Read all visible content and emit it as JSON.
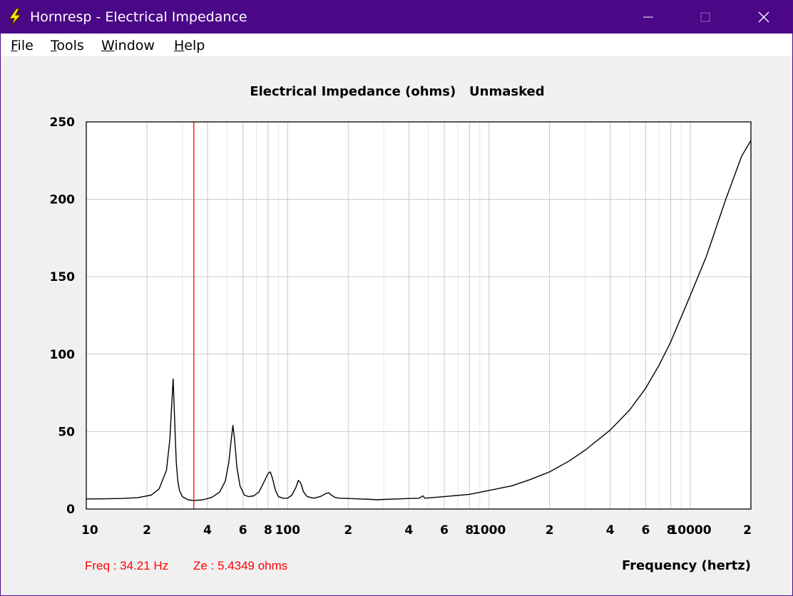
{
  "window": {
    "title": "Hornresp - Electrical Impedance",
    "icon": "lightning-bolt-icon",
    "controls": [
      "minimize-icon",
      "maximize-icon",
      "close-icon"
    ],
    "colors": {
      "titlebar": "#4a0786",
      "plot_background": "#ffffff",
      "grid": "#c8c8c8",
      "trace": "#000000",
      "marker": "#ff0000"
    }
  },
  "menu": {
    "items": [
      {
        "label": "File",
        "mnemonic": "F",
        "rest": "ile"
      },
      {
        "label": "Tools",
        "mnemonic": "T",
        "rest": "ools"
      },
      {
        "label": "Window",
        "mnemonic": "W",
        "rest": "indow"
      },
      {
        "label": "Help",
        "mnemonic": "H",
        "rest": "elp"
      }
    ]
  },
  "readout": {
    "freq": "Freq : 34.21 Hz",
    "ze": "Ze : 5.4349 ohms"
  },
  "chart_data": {
    "type": "line",
    "title": "Electrical Impedance (ohms)   Unmasked",
    "xlabel": "Frequency (hertz)",
    "ylabel": "",
    "x_scale": "log",
    "xlim": [
      10,
      20000
    ],
    "ylim": [
      0,
      250
    ],
    "grid": true,
    "y_ticks": [
      0,
      50,
      100,
      150,
      200,
      250
    ],
    "y_tick_labels": [
      "0",
      "50",
      "100",
      "150",
      "200",
      "250"
    ],
    "x_ticks": [
      10,
      20,
      40,
      60,
      80,
      100,
      200,
      400,
      600,
      800,
      1000,
      2000,
      4000,
      6000,
      8000,
      10000,
      20000
    ],
    "x_tick_labels": [
      "10",
      "2",
      "4",
      "6",
      "8",
      "100",
      "2",
      "4",
      "6",
      "8",
      "1000",
      "2",
      "4",
      "6",
      "8",
      "10000",
      "2"
    ],
    "marker": {
      "x": 34.21,
      "y": 5.4349
    },
    "series": [
      {
        "x": [
          10,
          12,
          15,
          18,
          21,
          23,
          25,
          26,
          26.5,
          27,
          27.3,
          27.6,
          28,
          28.5,
          29,
          30,
          32,
          34.21,
          38,
          42,
          46,
          49,
          51,
          52.5,
          53.5,
          54.5,
          56,
          58,
          61,
          64,
          68,
          72,
          76,
          80,
          82,
          84,
          87,
          90,
          95,
          100,
          105,
          110,
          113,
          116,
          120,
          125,
          135,
          145,
          155,
          160,
          165,
          172,
          180,
          200,
          230,
          260,
          280,
          300,
          350,
          400,
          450,
          470,
          480,
          500,
          600,
          800,
          1000,
          1300,
          1600,
          2000,
          2500,
          3000,
          4000,
          5000,
          6000,
          7000,
          8000,
          10000,
          12000,
          15000,
          18000,
          20000
        ],
        "y": [
          6.5,
          6.6,
          6.8,
          7.3,
          9,
          13,
          25,
          45,
          65,
          84,
          68,
          50,
          30,
          18,
          12,
          8,
          6,
          5.43,
          6,
          7.5,
          11,
          18,
          30,
          45,
          54,
          45,
          27,
          15,
          9,
          8,
          8.5,
          11,
          17,
          23,
          24,
          20,
          12,
          8,
          7,
          7,
          9,
          14,
          18.5,
          17,
          11,
          8,
          7,
          8,
          10,
          10.5,
          9,
          7.5,
          7,
          6.8,
          6.5,
          6.2,
          6,
          6.2,
          6.5,
          6.8,
          7,
          8.5,
          7,
          7.2,
          8,
          9.5,
          12,
          15,
          19,
          24,
          31,
          38,
          51,
          64,
          78,
          93,
          108,
          138,
          163,
          200,
          228,
          238
        ]
      }
    ]
  }
}
